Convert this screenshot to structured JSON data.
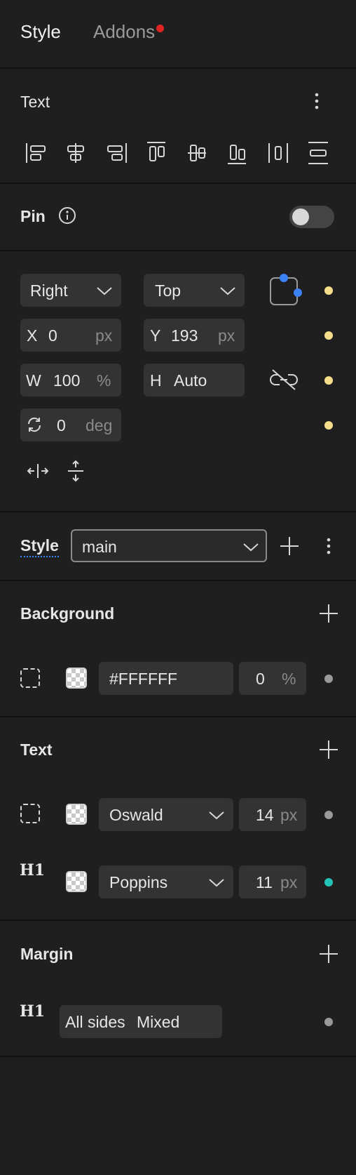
{
  "tabs": {
    "style": "Style",
    "addons": "Addons"
  },
  "text_section": {
    "title": "Text"
  },
  "pin": {
    "label": "Pin",
    "enabled": false
  },
  "position": {
    "h_anchor": "Right",
    "v_anchor": "Top",
    "x": {
      "label": "X",
      "value": "0",
      "unit": "px"
    },
    "y": {
      "label": "Y",
      "value": "193",
      "unit": "px"
    },
    "w": {
      "label": "W",
      "value": "100",
      "unit": "%"
    },
    "h": {
      "label": "H",
      "value": "Auto"
    },
    "rotation": {
      "value": "0",
      "unit": "deg"
    }
  },
  "style_row": {
    "label": "Style",
    "value": "main"
  },
  "background": {
    "title": "Background",
    "color": "#FFFFFF",
    "opacity": "0",
    "opacity_unit": "%"
  },
  "text_styles": {
    "title": "Text",
    "rows": [
      {
        "font": "Oswald",
        "size": "14",
        "unit": "px"
      },
      {
        "tag": "H1",
        "font": "Poppins",
        "size": "11",
        "unit": "px"
      }
    ]
  },
  "margin": {
    "title": "Margin",
    "tag": "H1",
    "sides": "All sides",
    "value": "Mixed"
  },
  "colors": {
    "accent_blue": "#3b82f6",
    "notification_red": "#e02424",
    "dot_yellow": "#f5dd8a",
    "dot_gray": "#9a9a9a",
    "dot_teal": "#22c4b8"
  }
}
